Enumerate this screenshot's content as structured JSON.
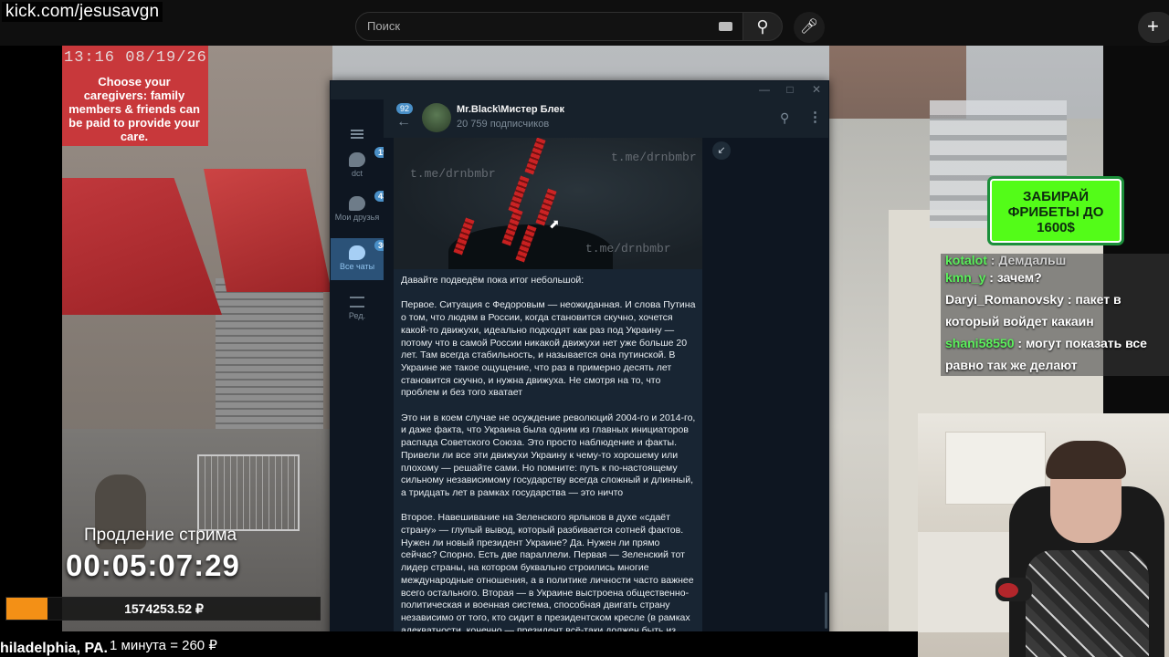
{
  "browser": {
    "url_overlay": "kick.com/jesusavgn",
    "search_placeholder": "Поиск",
    "create_label": "+"
  },
  "stream": {
    "cam_timestamp": "13:16 08/19/26",
    "store_sign": "Choose your caregivers: family members & friends can be paid to provide your care.",
    "promo_banner": "ЗАБИРАЙ ФРИБЕТЫ ДО 1600$",
    "chat": [
      {
        "user": "kotalot",
        "message": "Демдальш",
        "user_color": "#5bf05c"
      },
      {
        "user": "kmn_y",
        "message": "зачем?",
        "user_color": "#5bf05c"
      },
      {
        "user": "Daryi_Romanovsky",
        "message": "пакет в который войдет какаин",
        "user_color": "#ffffff"
      },
      {
        "user": "shani58550",
        "message": "могут показать все равно так же делают",
        "user_color": "#5bf05c"
      }
    ],
    "prolong_label": "Продление стрима",
    "timer": "00:05:07:29",
    "goal_amount": "1574253.52 ₽",
    "goal_progress": 0.13,
    "location": "hiladelphia, PA.",
    "rate": "1 минута = 260 ₽"
  },
  "telegram": {
    "sidebar": [
      {
        "label": "dct",
        "badge": "193",
        "active": false
      },
      {
        "label": "Мои друзья",
        "badge": "43",
        "active": false
      },
      {
        "label": "Все чаты",
        "badge": "363",
        "active": true
      },
      {
        "label": "Ред.",
        "badge": "",
        "active": false
      }
    ],
    "back_count": "92",
    "channel_name": "Mr.Black\\Мистер Блек",
    "channel_subs": "20 759 подписчиков",
    "map_watermark": "t.me/drnbmbr",
    "paragraphs": [
      "Давайте подведём пока итог небольшой:",
      "Первое. Ситуация с Федоровым — неожиданная. И слова Путина о том, что людям в России, когда становится скучно, хочется какой-то движухи, идеально подходят как раз под Украину — потому что в самой России никакой движухи нет уже больше 20 лет. Там всегда стабильность, и называется она путинской. В Украине же такое ощущение, что раз в примерно десять лет становится скучно, и нужна движуха. Не смотря на то, что проблем и без того хватает",
      "Это ни в коем случае не осуждение революций 2004-го и 2014-го, и даже факта, что Украина была одним из главных инициаторов распада Советского Союза. Это просто наблюдение и факты. Привели ли все эти движухи Украину к чему-то хорошему или плохому — решайте сами. Но помните: путь к по-настоящему сильному независимому государству всегда сложный и длинный, а тридцать лет в рамках государства — это ничто",
      "Второе. Навешивание на Зеленского ярлыков в духе «сдаёт страну» — глупый вывод, который разбивается сотней фактов. Нужен ли новый президент Украине? Да. Нужен ли прямо сейчас? Спорно. Есть две параллели. Первая — Зеленский тот лидер страны, на котором буквально строились многие международные отношения, а в политике личности часто важнее всего остального. Вторая — в Украине выстроена общественно-политическая и военная система, способная двигать страну независимо от того, кто сидит в президентском кресле (в рамках адекватности, конечно — президент всё-таки должен быть из одной или хотя бы соседней рощи с народом)"
    ]
  }
}
